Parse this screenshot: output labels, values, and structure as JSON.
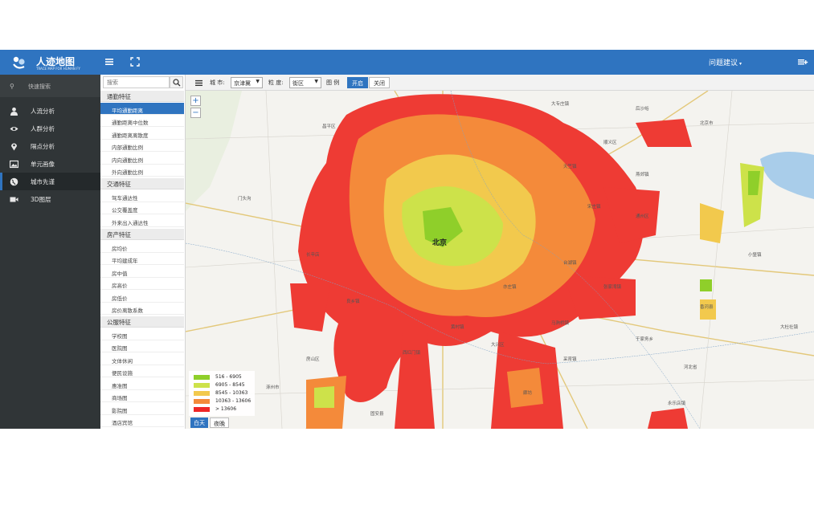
{
  "header": {
    "app_title": "人迹地图",
    "app_subtitle": "TRACE MAP FOR HUMAN FY",
    "feedback_label": "问题建议",
    "feedback_suffix": "▾",
    "accent_color": "#2f74c0"
  },
  "sidebar": {
    "quick_search_label": "快速搜索",
    "items": [
      {
        "label": "人流分析",
        "icon": "user-icon"
      },
      {
        "label": "人群分析",
        "icon": "eye-icon"
      },
      {
        "label": "隔点分析",
        "icon": "map-pin-icon"
      },
      {
        "label": "单元画像",
        "icon": "image-icon"
      },
      {
        "label": "城市先谨",
        "icon": "globe-icon",
        "active": true
      },
      {
        "label": "3D图层",
        "icon": "video-icon"
      }
    ]
  },
  "category_panel": {
    "search_placeholder": "搜索",
    "groups": [
      {
        "title": "通勤特征",
        "items": [
          "平均通勤距离",
          "通勤距离中位数",
          "通勤距离离散度",
          "内部通勤比例",
          "内向通勤比例",
          "外向通勤比例"
        ],
        "active_index": 0
      },
      {
        "title": "交通特征",
        "items": [
          "驾车通达性",
          "公交覆盖度",
          "外来出入通达性"
        ]
      },
      {
        "title": "房产特征",
        "items": [
          "房均价",
          "平均建成年",
          "房中值",
          "房高价",
          "房低价",
          "房价离散系数"
        ]
      },
      {
        "title": "公服特征",
        "items": [
          "学校图",
          "医院图",
          "文体休闲",
          "便民设施",
          "惠准图",
          "商场图",
          "影院图",
          "酒店宾馆"
        ]
      }
    ]
  },
  "toolbar": {
    "city_label": "城 市:",
    "city_value": "京津冀",
    "granularity_label": "粒 度:",
    "granularity_value": "街区",
    "legend_label": "图 例",
    "legend_on": "开启",
    "legend_off": "关闭"
  },
  "map": {
    "zoom_in": "+",
    "zoom_out": "−",
    "center_label": "北京",
    "places": [
      "大专庄镇",
      "后沙峪",
      "北京市",
      "天竺镇",
      "通州区",
      "大兴区",
      "房山区",
      "门头沟",
      "昌平区",
      "顺义区",
      "大杜社镇",
      "香河县",
      "燕郊镇",
      "河北省",
      "固安县",
      "涿州市",
      "廊坊",
      "良乡镇",
      "长辛店",
      "西红门镇",
      "亦庄镇",
      "马驹桥镇",
      "宋庄镇",
      "台湖镇",
      "张家湾镇",
      "黄村镇",
      "采育镇",
      "于家务乡",
      "永乐店镇",
      "小堡镇"
    ],
    "legend": [
      {
        "range": "516 - 6905",
        "color": "#8fcf2a"
      },
      {
        "range": "6905 - 8545",
        "color": "#cde24a"
      },
      {
        "range": "8545 - 10363",
        "color": "#f2c94d"
      },
      {
        "range": "10363 - 13606",
        "color": "#f48a3a"
      },
      {
        "range": "> 13606",
        "color": "#ee2727"
      }
    ],
    "day_label": "白天",
    "night_label": "夜晚"
  }
}
